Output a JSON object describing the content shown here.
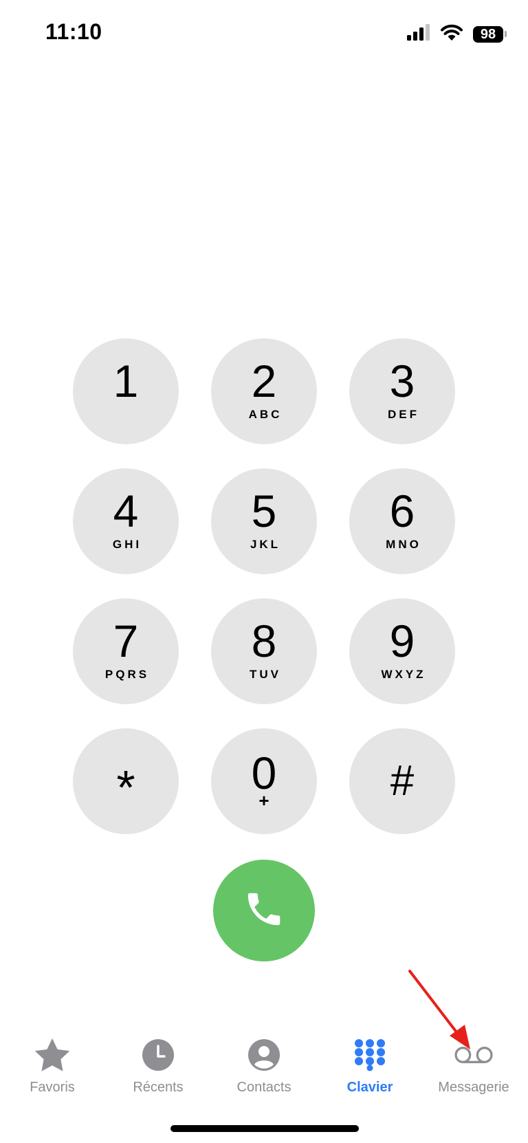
{
  "status_bar": {
    "time": "11:10",
    "battery_level": "98"
  },
  "keypad": {
    "keys": [
      {
        "digit": "1",
        "letters": ""
      },
      {
        "digit": "2",
        "letters": "ABC"
      },
      {
        "digit": "3",
        "letters": "DEF"
      },
      {
        "digit": "4",
        "letters": "GHI"
      },
      {
        "digit": "5",
        "letters": "JKL"
      },
      {
        "digit": "6",
        "letters": "MNO"
      },
      {
        "digit": "7",
        "letters": "PQRS"
      },
      {
        "digit": "8",
        "letters": "TUV"
      },
      {
        "digit": "9",
        "letters": "WXYZ"
      },
      {
        "digit": "*",
        "letters": ""
      },
      {
        "digit": "0",
        "letters": "+"
      },
      {
        "digit": "#",
        "letters": ""
      }
    ]
  },
  "call_button": {
    "icon": "phone-icon",
    "color": "#65c466"
  },
  "tabbar": {
    "active_color": "#2f7cf6",
    "inactive_color": "#8e8e93",
    "tabs": [
      {
        "label": "Favoris",
        "icon": "star-icon"
      },
      {
        "label": "Récents",
        "icon": "clock-icon"
      },
      {
        "label": "Contacts",
        "icon": "person-icon"
      },
      {
        "label": "Clavier",
        "icon": "keypad-icon",
        "active": true
      },
      {
        "label": "Messagerie",
        "icon": "voicemail-icon"
      }
    ]
  },
  "annotation": {
    "color": "#e8201c",
    "points_to": "voicemail-icon"
  }
}
